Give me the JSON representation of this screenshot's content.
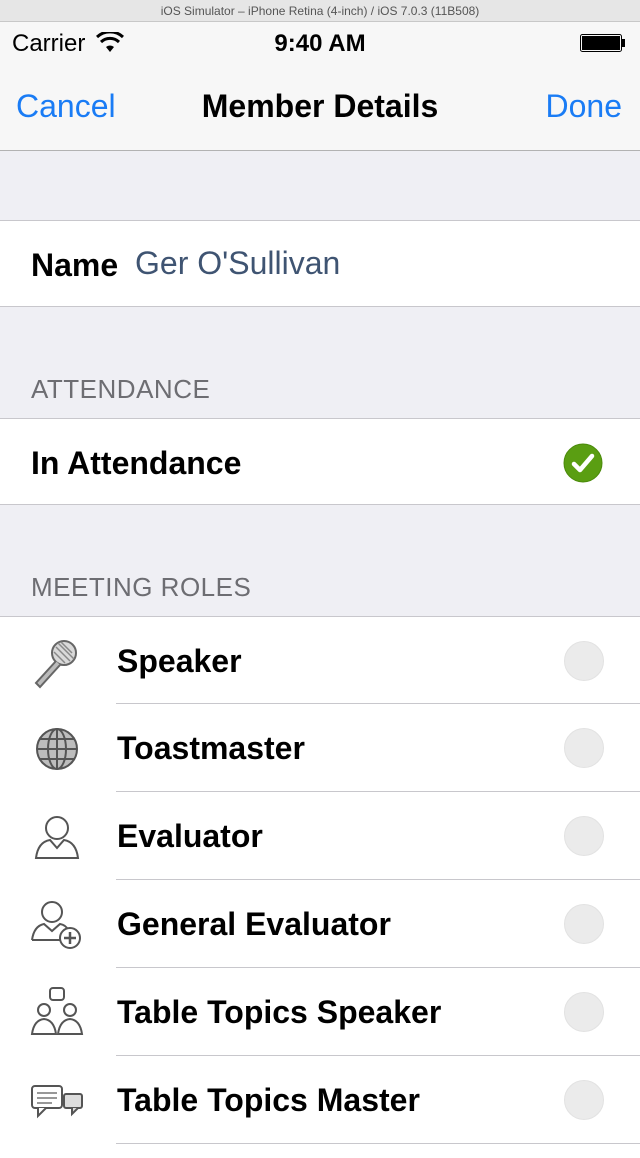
{
  "window": {
    "title": "iOS Simulator – iPhone Retina (4-inch) / iOS 7.0.3 (11B508)"
  },
  "status_bar": {
    "carrier": "Carrier",
    "time": "9:40 AM"
  },
  "nav": {
    "cancel_label": "Cancel",
    "title": "Member Details",
    "done_label": "Done",
    "accent_color": "#1a7cf5"
  },
  "name_cell": {
    "label": "Name",
    "value": "Ger O'Sullivan"
  },
  "attendance": {
    "header": "ATTENDANCE",
    "label": "In Attendance",
    "checked": true,
    "icon": "checkmark-circle-icon",
    "check_color": "#5a9e12"
  },
  "roles": {
    "header": "MEETING ROLES",
    "items": [
      {
        "label": "Speaker",
        "icon": "microphone-icon",
        "selected": false
      },
      {
        "label": "Toastmaster",
        "icon": "globe-icon",
        "selected": false
      },
      {
        "label": "Evaluator",
        "icon": "person-icon",
        "selected": false
      },
      {
        "label": "General Evaluator",
        "icon": "person-add-icon",
        "selected": false
      },
      {
        "label": "Table Topics Speaker",
        "icon": "group-icon",
        "selected": false
      },
      {
        "label": "Table Topics Master",
        "icon": "chat-icon",
        "selected": false
      }
    ]
  }
}
